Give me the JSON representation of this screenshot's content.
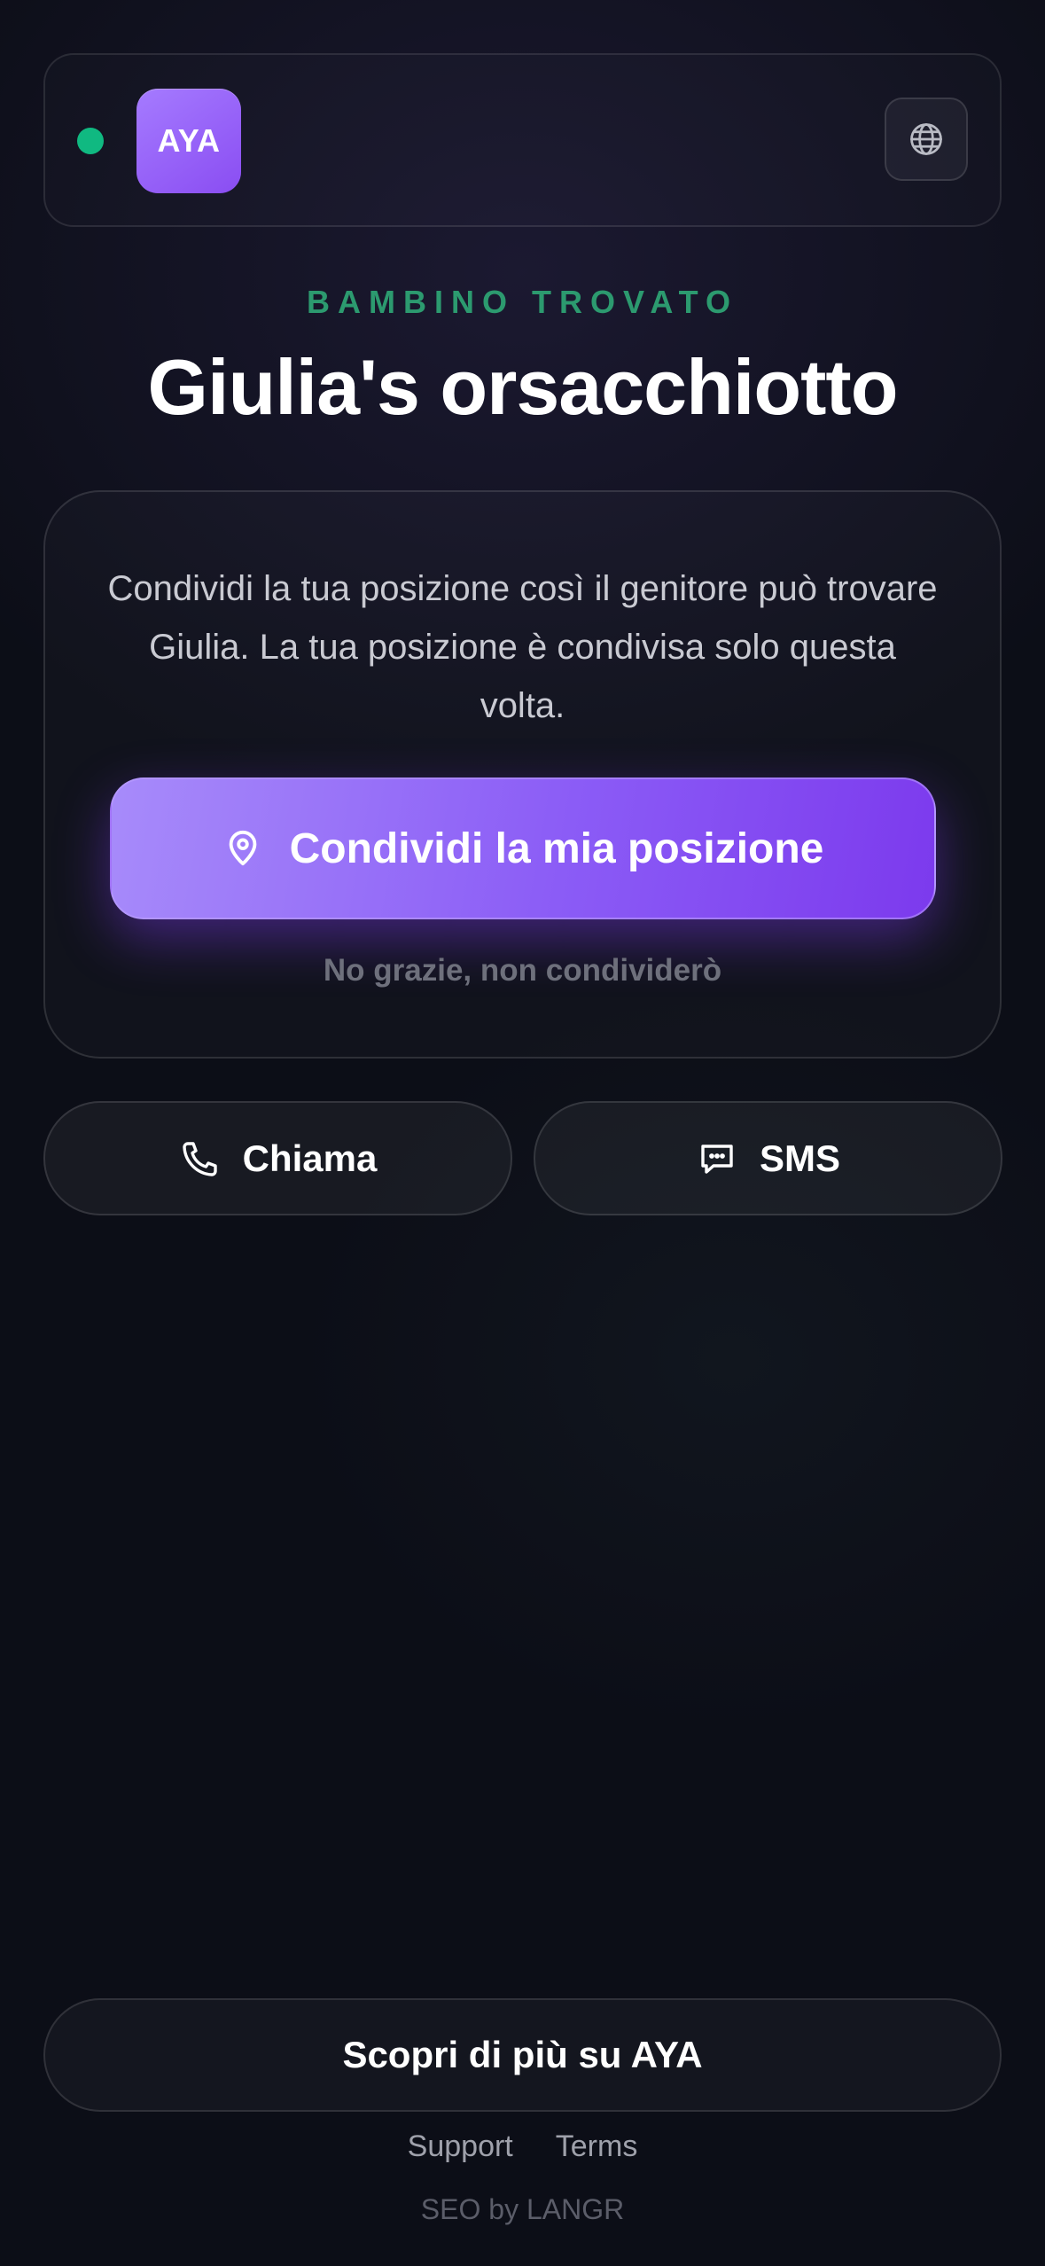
{
  "header": {
    "logo_text": "AYA",
    "status_color": "#10b981",
    "status_icon": "online-status-dot",
    "language_icon": "globe-icon"
  },
  "hero": {
    "eyebrow": "BAMBINO TROVATO",
    "title": "Giulia's orsacchiotto"
  },
  "share_card": {
    "description": "Condividi la tua posizione così il genitore può trovare Giulia. La tua posizione è condivisa solo questa volta.",
    "share_button_label": "Condividi la mia posizione",
    "share_icon": "location-pin-icon",
    "decline_label": "No grazie, non condividerò"
  },
  "contact": {
    "call_label": "Chiama",
    "call_icon": "phone-icon",
    "sms_label": "SMS",
    "sms_icon": "chat-bubble-icon"
  },
  "footer": {
    "learn_more_label": "Scopri di più su AYA",
    "links": [
      "Support",
      "Terms"
    ],
    "seo_text": "SEO by LANGR"
  },
  "colors": {
    "accent": "#8b5cf6",
    "accent_light": "#a78bfa",
    "eyebrow_green": "#2c9a6f",
    "background": "#0c0e17"
  }
}
